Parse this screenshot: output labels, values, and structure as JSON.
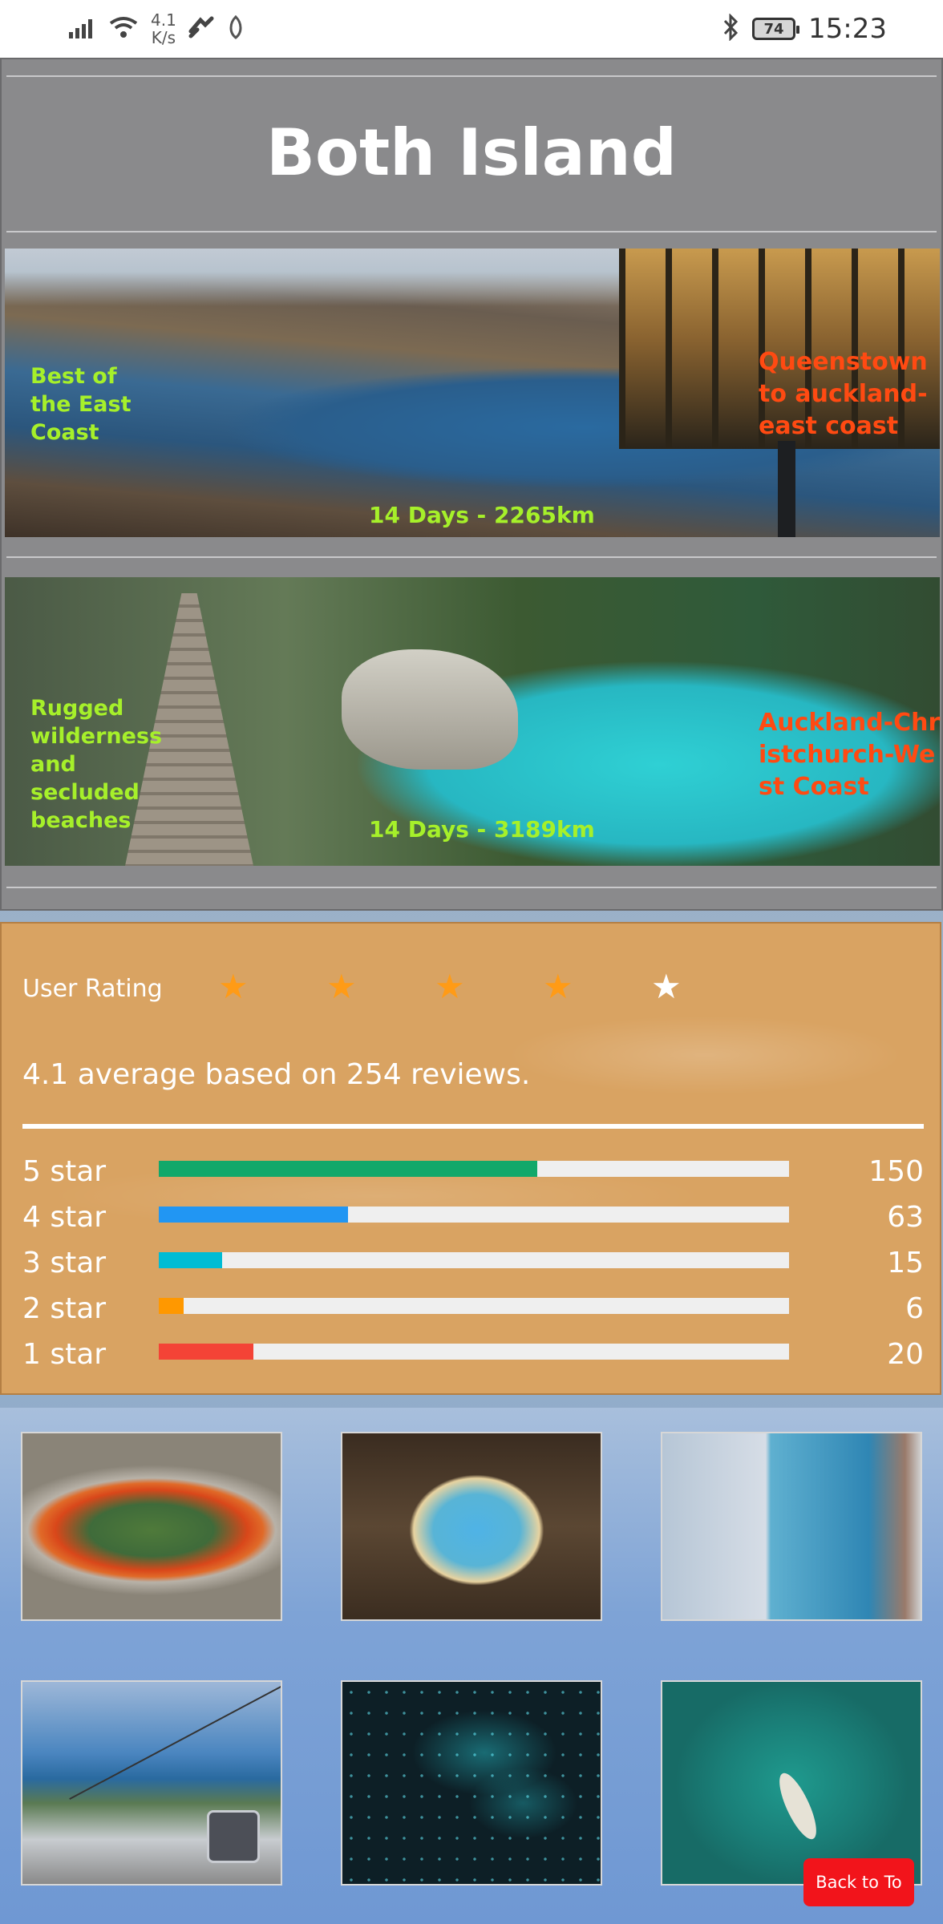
{
  "status_bar": {
    "net_speed_value": "4.1",
    "net_speed_unit": "K/s",
    "battery": "74",
    "time": "15:23"
  },
  "header": {
    "title": "Both Island"
  },
  "tours": [
    {
      "description": "Best of the East Coast",
      "route": "Queenstown to auckland-east coast",
      "stats": "14 Days - 2265km"
    },
    {
      "description": "Rugged wilderness and secluded beaches",
      "route": "Auckland-Christchurch-West Coast",
      "stats": "14 Days - 3189km"
    }
  ],
  "rating": {
    "label": "User Rating",
    "stars_filled": 4,
    "stars_total": 5,
    "average_text": "4.1 average based on 254 reviews.",
    "breakdown": [
      {
        "label": "5 star",
        "count": "150",
        "fraction": 0.6,
        "color": "#12a86a"
      },
      {
        "label": "4 star",
        "count": "63",
        "fraction": 0.3,
        "color": "#2196f3"
      },
      {
        "label": "3 star",
        "count": "15",
        "fraction": 0.1,
        "color": "#00bcd4"
      },
      {
        "label": "2 star",
        "count": "6",
        "fraction": 0.04,
        "color": "#ff9800"
      },
      {
        "label": "1 star",
        "count": "20",
        "fraction": 0.15,
        "color": "#f44336"
      }
    ]
  },
  "gallery": {
    "images": [
      "geothermal-pool",
      "cathedral-cove",
      "glacier-hikers",
      "queenstown-gondola",
      "glowworm-cave",
      "kayak-lake"
    ]
  },
  "back_to_top": {
    "label": "Back to To"
  },
  "colors": {
    "header_bg": "#8a8a8c",
    "rating_panel_bg": "#d9a362",
    "star_filled": "#ff9b16",
    "tour_desc_text": "#a6f02a",
    "tour_route_text": "#ff4a12",
    "back_to_top_bg": "#f2141b"
  }
}
